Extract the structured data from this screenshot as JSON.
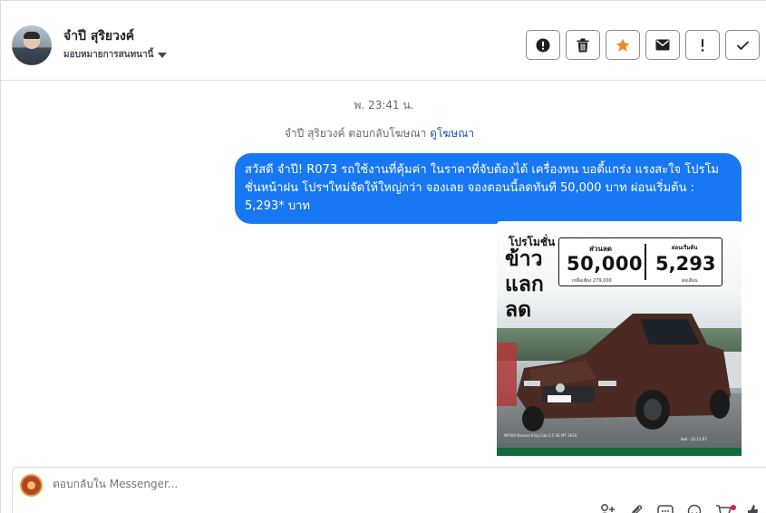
{
  "header": {
    "name": "จำปี สุริยวงค์",
    "assign_label": "มอบหมายการสนทนานี้",
    "actions": [
      {
        "name": "action-alert-icon",
        "icon": "exclamation-circle"
      },
      {
        "name": "action-delete-icon",
        "icon": "trash"
      },
      {
        "name": "action-star-icon",
        "icon": "star",
        "color": "#f5831f"
      },
      {
        "name": "action-mail-icon",
        "icon": "envelope"
      },
      {
        "name": "action-important-icon",
        "icon": "exclamation"
      },
      {
        "name": "action-done-icon",
        "icon": "check"
      }
    ]
  },
  "thread": {
    "timestamp": "พ. 23:41 น.",
    "ad_reply_text": "จำปี สุริยวงค์ ตอบกลับโฆษณา",
    "ad_link": "ดูโฆษณา",
    "message": "สวัสดี จำปี! R073 รถใช้งานที่คุ้มค่า ในราคาที่จับต้องได้ เครื่องทน บอดี้แกร่ง แรงสะใจ โปรโมชั่นหน้าฝน โปรฯใหม่จัดให้ใหญ่กว่า จองเลย จองตอนนี้ลดทันที 50,000 บาท ผ่อนเริ่มต้น : 5,293* บาท",
    "bubble_color": "#1877f2",
    "promo": {
      "heading_small": "โปรโมชั่น",
      "heading_big_1": "ข้าว",
      "heading_big_2": "แลก",
      "heading_big_3": "ลด",
      "discount_label": "ส่วนลด",
      "discount_value": "50,000",
      "discount_sub": "เหลือเพียง 279,000",
      "installment_label": "ผ่อนเริ่มต้น",
      "installment_value": "5,293",
      "installment_sub": "ต่อเดือน",
      "fine_print_left": "NP300 Navara King Cab 2.5 SE MT 2018",
      "fine_print_right": "ลิงค์ - 22.11.67"
    }
  },
  "composer": {
    "placeholder": "ตอบกลับใน Messenger...",
    "tools": [
      "add-person-icon",
      "attachment-icon",
      "saved-reply-icon",
      "emoji-icon",
      "cart-icon",
      "like-icon"
    ]
  }
}
